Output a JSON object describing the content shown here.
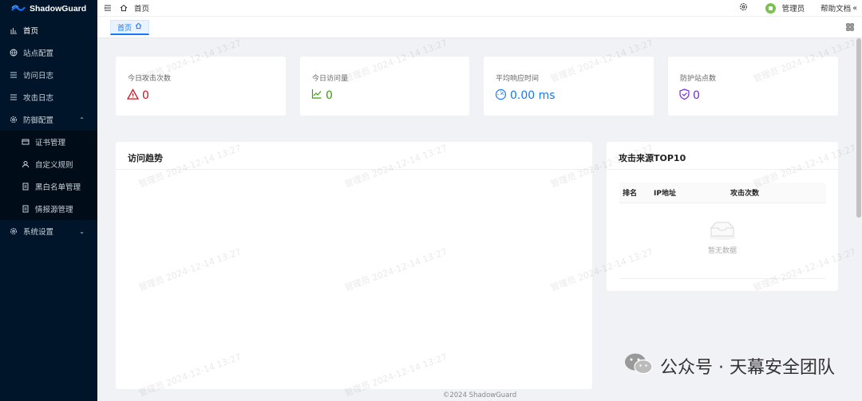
{
  "app": {
    "name": "ShadowGuard"
  },
  "sidebar": {
    "items": [
      {
        "label": "首页",
        "icon": "bar-chart-icon"
      },
      {
        "label": "站点配置",
        "icon": "globe-icon"
      },
      {
        "label": "访问日志",
        "icon": "list-icon"
      },
      {
        "label": "攻击日志",
        "icon": "list-icon"
      },
      {
        "label": "防御配置",
        "icon": "gear-icon"
      },
      {
        "label": "系统设置",
        "icon": "gear-icon"
      }
    ],
    "subitems": [
      {
        "label": "证书管理",
        "icon": "card-icon"
      },
      {
        "label": "自定义规则",
        "icon": "user-icon"
      },
      {
        "label": "黑白名单管理",
        "icon": "doc-icon"
      },
      {
        "label": "情报源管理",
        "icon": "doc-icon"
      }
    ]
  },
  "header": {
    "breadcrumb": "首页",
    "username": "管理员",
    "help": "帮助文档"
  },
  "tabs": [
    {
      "label": "首页"
    }
  ],
  "stats": [
    {
      "title": "今日攻击次数",
      "value": "0",
      "icon": "warning-icon",
      "color": "#cf1322"
    },
    {
      "title": "今日访问量",
      "value": "0",
      "icon": "line-chart-icon",
      "color": "#389e0d"
    },
    {
      "title": "平均响应时间",
      "value": "0.00 ms",
      "icon": "dashboard-icon",
      "color": "#1677ff"
    },
    {
      "title": "防护站点数",
      "value": "0",
      "icon": "shield-check-icon",
      "color": "#722ed1"
    }
  ],
  "trend": {
    "title": "访问趋势"
  },
  "top10": {
    "title": "攻击来源TOP10",
    "columns": [
      "排名",
      "IP地址",
      "攻击次数"
    ],
    "empty": "暂无数据"
  },
  "watermark": "管理员 2024-12-14 13:27",
  "footer": "©2024 ShadowGuard",
  "overlay": {
    "text": "公众号 · 天幕安全团队"
  }
}
